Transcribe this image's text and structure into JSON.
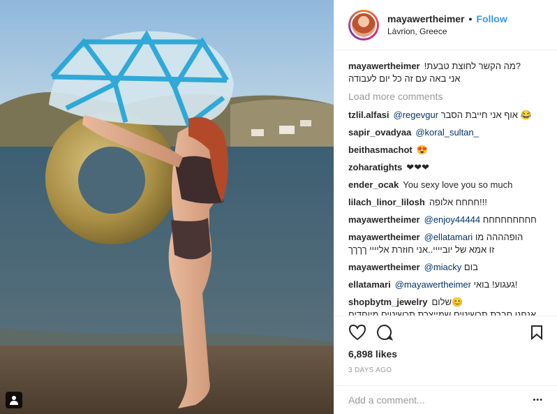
{
  "header": {
    "username": "mayawertheimer",
    "separator": "•",
    "follow": "Follow",
    "location": "Lávrion, Greece"
  },
  "caption": {
    "user": "mayawertheimer",
    "line1": "?מה הקשר לחוצת טבעת!",
    "line2": "אני באה עם זה כל יום לעבודה"
  },
  "load_more": "Load more comments",
  "comments": [
    {
      "user": "tzlil.alfasi",
      "mention": "@regevgur",
      "text": "אוף אני חייבת הסבר 😂"
    },
    {
      "user": "sapir_ovadyaa",
      "mention": "@koral_sultan_",
      "text": ""
    },
    {
      "user": "beithasmachot",
      "mention": "",
      "text": "😍"
    },
    {
      "user": "zoharatights",
      "mention": "",
      "text": "❤❤❤"
    },
    {
      "user": "ender_ocak",
      "mention": "",
      "text": "You sexy love you so much"
    },
    {
      "user": "lilach_linor_lilosh",
      "mention": "",
      "text": "חחחח אלופה!!!"
    },
    {
      "user": "mayawertheimer",
      "mention": "@enjoy44444",
      "text": "חחחחחחחחח"
    },
    {
      "user": "mayawertheimer",
      "mention": "@ellatamari",
      "text": "הופהההה מו",
      "line2": "זו אמא של יוביייי..אני חוזרת אליייי ךךךך"
    },
    {
      "user": "mayawertheimer",
      "mention": "@miacky",
      "text": "בום"
    },
    {
      "user": "ellatamari",
      "mention": "@mayawertheimer",
      "text": "געגוע! בואי!"
    },
    {
      "user": "shopbytm_jewelry",
      "mention": "",
      "text": "שלום😊",
      "line2": "אנחנו חברת תכשיטים שמייצרת תכשיטים מיוחדים"
    }
  ],
  "likes": "6,898 likes",
  "time": "3 DAYS AGO",
  "add_comment": {
    "placeholder": "Add a comment...",
    "more": "•••"
  },
  "icons": {
    "like": "heart-icon",
    "comment": "comment-icon",
    "save": "bookmark-icon",
    "user_tag": "user-tag-icon"
  }
}
